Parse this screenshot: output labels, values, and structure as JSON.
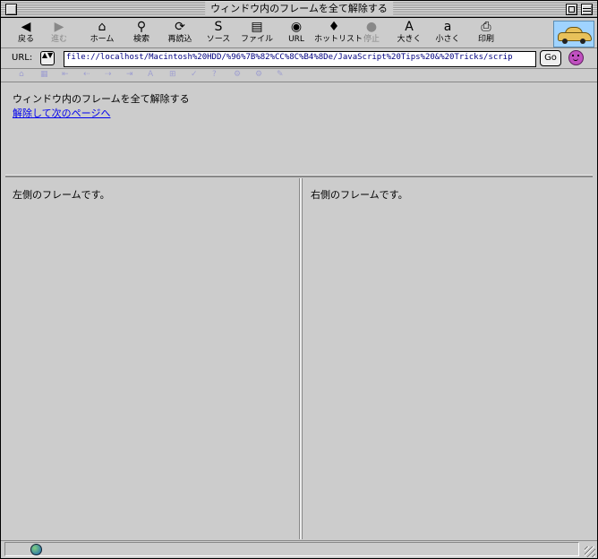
{
  "window": {
    "title": "ウィンドウ内のフレームを全て解除する"
  },
  "toolbar": {
    "items": [
      {
        "label": "戻る",
        "icon": "back-arrow-icon",
        "glyph": "◀",
        "disabled": false
      },
      {
        "label": "進む",
        "icon": "forward-arrow-icon",
        "glyph": "▶",
        "disabled": true
      },
      {
        "label": "ホーム",
        "icon": "home-icon",
        "glyph": "⌂",
        "disabled": false
      },
      {
        "label": "検索",
        "icon": "search-icon",
        "glyph": "⚲",
        "disabled": false
      },
      {
        "label": "再読込",
        "icon": "reload-icon",
        "glyph": "⟳",
        "disabled": false
      },
      {
        "label": "ソース",
        "icon": "source-icon",
        "glyph": "S",
        "disabled": false
      },
      {
        "label": "ファイル",
        "icon": "file-icon",
        "glyph": "▤",
        "disabled": false
      },
      {
        "label": "URL",
        "icon": "url-globe-icon",
        "glyph": "◉",
        "disabled": false
      },
      {
        "label": "ホットリスト",
        "icon": "hotlist-icon",
        "glyph": "♦",
        "disabled": false
      },
      {
        "label": "停止",
        "icon": "stop-icon",
        "glyph": "●",
        "disabled": true
      },
      {
        "label": "大きく",
        "icon": "larger-text-icon",
        "glyph": "A",
        "disabled": false
      },
      {
        "label": "小さく",
        "icon": "smaller-text-icon",
        "glyph": "a",
        "disabled": false
      },
      {
        "label": "印刷",
        "icon": "print-icon",
        "glyph": "⎙",
        "disabled": false
      }
    ]
  },
  "urlbar": {
    "label": "URL:",
    "arrows": "▲▼",
    "value": "file://localhost/Macintosh%20HDD/%96%7B%82%CC%8C%B4%8De/JavaScript%20Tips%20&%20Tricks/scrip",
    "go_label": "Go"
  },
  "navbar2": {
    "glyphs": [
      "⌂",
      "▦",
      "⇤",
      "⇠",
      "⇢",
      "⇥",
      "A",
      "⊞",
      "✓",
      "?",
      "⚙",
      "⚙",
      "✎"
    ]
  },
  "top_frame": {
    "text": "ウィンドウ内のフレームを全て解除する",
    "link": "解除して次のページへ"
  },
  "left_frame": {
    "text": "左側のフレームです。"
  },
  "right_frame": {
    "text": "右側のフレームです。"
  },
  "colors": {
    "link": "#0000ee",
    "background": "#cccccc"
  }
}
